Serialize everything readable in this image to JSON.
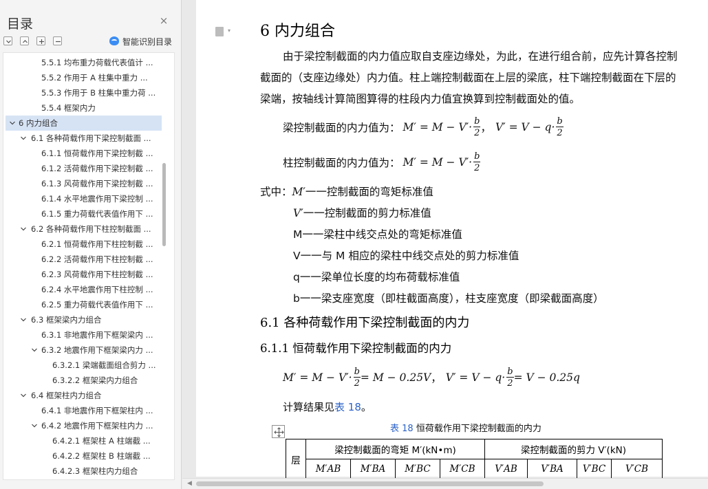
{
  "toc": {
    "title": "目录",
    "close_icon": "×",
    "ai_label": "智能识别目录",
    "items": [
      {
        "label": "5.5.1  均布重力荷载代表值计 ...",
        "level": 2,
        "expander": "none"
      },
      {
        "label": "5.5.2  作用于 A 柱集中重力 ...",
        "level": 2,
        "expander": "none"
      },
      {
        "label": "5.5.3  作用于 B 柱集中重力荷 ...",
        "level": 2,
        "expander": "none"
      },
      {
        "label": "5.5.4  框架内力",
        "level": 2,
        "expander": "none"
      },
      {
        "label": "6  内力组合",
        "level": 0,
        "expander": "open",
        "active": true
      },
      {
        "label": "6.1  各种荷载作用下梁控制截面 ...",
        "level": 1,
        "expander": "open"
      },
      {
        "label": "6.1.1  恒荷载作用下梁控制截 ...",
        "level": 2,
        "expander": "none"
      },
      {
        "label": "6.1.2  活荷载作用下梁控制截 ...",
        "level": 2,
        "expander": "none"
      },
      {
        "label": "6.1.3  风荷载作用下梁控制截 ...",
        "level": 2,
        "expander": "none"
      },
      {
        "label": "6.1.4  水平地震作用下梁控制 ...",
        "level": 2,
        "expander": "none"
      },
      {
        "label": "6.1.5  重力荷载代表值作用下 ...",
        "level": 2,
        "expander": "none"
      },
      {
        "label": "6.2  各种荷载作用下柱控制截面 ...",
        "level": 1,
        "expander": "open"
      },
      {
        "label": "6.2.1  恒荷载作用下柱控制截 ...",
        "level": 2,
        "expander": "none"
      },
      {
        "label": "6.2.2  活荷载作用下柱控制截 ...",
        "level": 2,
        "expander": "none"
      },
      {
        "label": "6.2.3  风荷载作用下柱控制截 ...",
        "level": 2,
        "expander": "none"
      },
      {
        "label": "6.2.4  水平地震作用下柱控制 ...",
        "level": 2,
        "expander": "none"
      },
      {
        "label": "6.2.5  重力荷载代表值作用下 ...",
        "level": 2,
        "expander": "none"
      },
      {
        "label": "6.3  框架梁内力组合",
        "level": 1,
        "expander": "open"
      },
      {
        "label": "6.3.1  非地震作用下框架梁内 ...",
        "level": 2,
        "expander": "none"
      },
      {
        "label": "6.3.2  地震作用下框架梁内力 ...",
        "level": 2,
        "expander": "open"
      },
      {
        "label": "6.3.2.1  梁端截面组合剪力 ...",
        "level": 3,
        "expander": "none"
      },
      {
        "label": "6.3.2.2  框架梁内力组合",
        "level": 3,
        "expander": "none"
      },
      {
        "label": "6.4  框架柱内力组合",
        "level": 1,
        "expander": "open"
      },
      {
        "label": "6.4.1  非地震作用下框架柱内 ...",
        "level": 2,
        "expander": "none"
      },
      {
        "label": "6.4.2  地震作用下框架柱内力 ...",
        "level": 2,
        "expander": "open"
      },
      {
        "label": "6.4.2.1  框架柱 A 柱端截 ...",
        "level": 3,
        "expander": "none"
      },
      {
        "label": "6.4.2.2  框架柱 B 柱端截 ...",
        "level": 3,
        "expander": "none"
      },
      {
        "label": "6.4.2.3  框架柱内力组合",
        "level": 3,
        "expander": "none"
      }
    ]
  },
  "doc": {
    "heading": "6  内力组合",
    "intro": [
      "由于梁控制截面的内力值应取自支座边缘处，为此，在进行组合前，应先计算各控制",
      "截面的（支座边缘处）内力值。柱上端控制截面在上层的梁底，柱下端控制截面在下层的",
      "梁端，按轴线计算简图算得的柱段内力值宜换算到控制截面处的值。"
    ],
    "beam_eq_label": "梁控制截面的内力值为：",
    "col_eq_label": "柱控制截面的内力值为：",
    "eq": {
      "m_prime_lhs": "M′ = M − V′·",
      "v_prime_lhs": "V′ = V − q·",
      "frac_num": "b",
      "frac_den": "2",
      "comma": "，",
      "specific_mid": " = M − 0.25V",
      "specific_v_mid": " = V − 0.25q"
    },
    "where_label": "式中：",
    "definitions": [
      {
        "sym": "M′",
        "text": "一一控制截面的弯矩标准值"
      },
      {
        "sym": "V′",
        "text": "一一控制截面的剪力标准值"
      },
      {
        "sym": "M",
        "text": "一一梁柱中线交点处的弯矩标准值"
      },
      {
        "sym": "V",
        "text": "一一与 M 相应的梁柱中线交点处的剪力标准值"
      },
      {
        "sym": "q",
        "text": "一一梁单位长度的均布荷载标准值"
      },
      {
        "sym": "b",
        "text": "一一梁支座宽度（即柱截面高度），柱支座宽度（即梁截面高度）"
      }
    ],
    "sec61": "6.1  各种荷载作用下梁控制截面的内力",
    "sec611": "6.1.1  恒荷载作用下梁控制截面的内力",
    "calc_ref_prefix": "计算结果见",
    "calc_ref_link": "表 18",
    "calc_ref_suffix": "。",
    "table_caption_link": "表 18",
    "table_caption_text": "   恒荷载作用下梁控制截面的内力",
    "table": {
      "layer_header": "层",
      "moment_header": "梁控制截面的弯矩 M′(kN•m)",
      "shear_header": "梁控制截面的剪力 V′(kN)",
      "moment_cols": [
        "M′AB",
        "M′BA",
        "M′BC",
        "M′CB"
      ],
      "shear_cols": [
        "V′AB",
        "V′BA",
        "V′BC",
        "V′CB"
      ]
    }
  },
  "colors": {
    "link": "#2c63c8",
    "active_toc": "#d6e3f5",
    "ai_icon": "#3b8df3"
  }
}
